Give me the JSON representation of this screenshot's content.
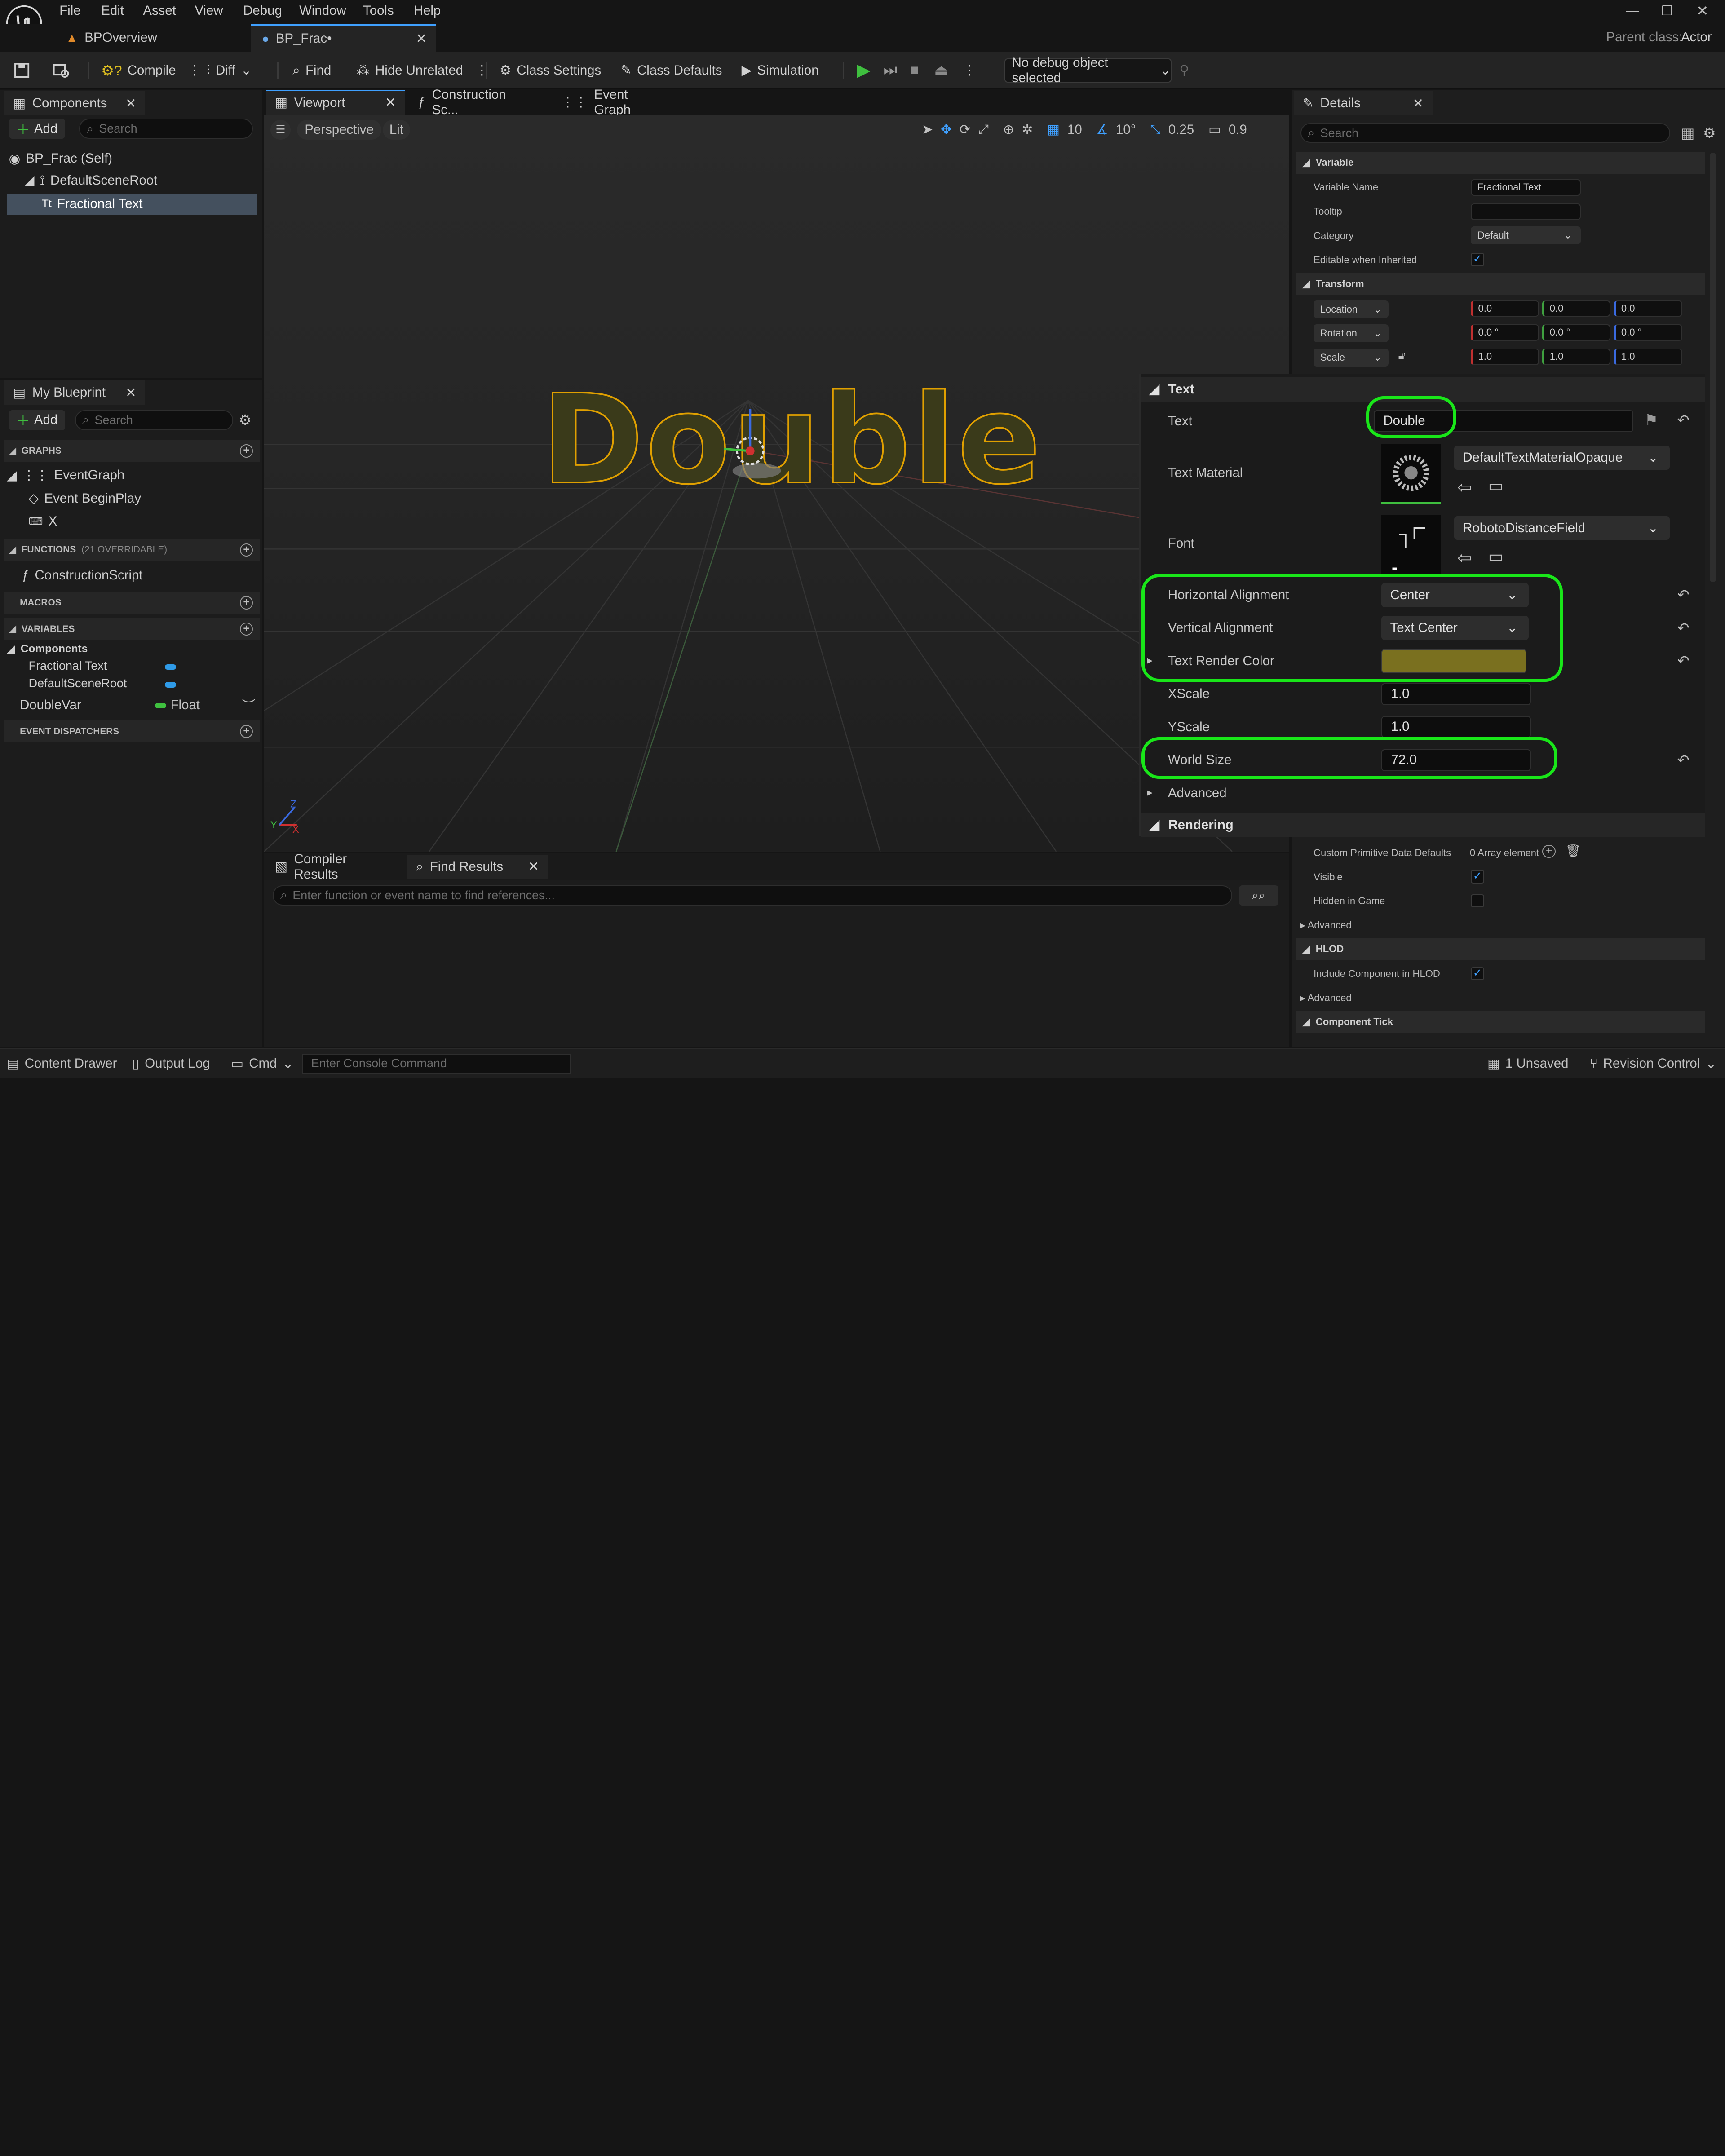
{
  "menu": [
    "File",
    "Edit",
    "Asset",
    "View",
    "Debug",
    "Window",
    "Tools",
    "Help"
  ],
  "doc_tabs": [
    {
      "label": "BPOverview"
    },
    {
      "label": "BP_Frac•"
    }
  ],
  "parent_class": {
    "label": "Parent class:",
    "value": "Actor"
  },
  "toolbar": {
    "compile": "Compile",
    "diff": "Diff",
    "find": "Find",
    "hide_unrelated": "Hide Unrelated",
    "class_settings": "Class Settings",
    "class_defaults": "Class Defaults",
    "simulation": "Simulation",
    "debug_object": "No debug object selected"
  },
  "components": {
    "tab": "Components",
    "add": "Add",
    "search_placeholder": "Search",
    "items": [
      "BP_Frac (Self)",
      "DefaultSceneRoot",
      "Fractional Text"
    ]
  },
  "viewport": {
    "tabs": [
      "Viewport",
      "Construction Sc...",
      "Event Graph"
    ],
    "perspective": "Perspective",
    "lit": "Lit",
    "grid_snap": "10",
    "rot_snap": "10°",
    "scale_snap": "0.25",
    "cam_speed": "0.9",
    "rendered_text": "Double"
  },
  "my_blueprint": {
    "tab": "My Blueprint",
    "add": "Add",
    "search_placeholder": "Search",
    "graphs_header": "GRAPHS",
    "event_graph": "EventGraph",
    "begin_play": "Event BeginPlay",
    "x_node": "X",
    "functions_header": "FUNCTIONS",
    "functions_note": "(21 OVERRIDABLE)",
    "construction_script": "ConstructionScript",
    "macros_header": "MACROS",
    "variables_header": "VARIABLES",
    "components_group": "Components",
    "var_items": [
      "Fractional Text",
      "DefaultSceneRoot"
    ],
    "double_var": {
      "name": "DoubleVar",
      "type": "Float"
    },
    "dispatchers_header": "EVENT DISPATCHERS"
  },
  "details": {
    "tab": "Details",
    "search_placeholder": "Search",
    "variable_section": "Variable",
    "variable_name_label": "Variable Name",
    "variable_name": "Fractional Text",
    "tooltip_label": "Tooltip",
    "category_label": "Category",
    "category": "Default",
    "editable_label": "Editable when Inherited",
    "transform_section": "Transform",
    "location": "Location",
    "rotation": "Rotation",
    "scale": "Scale",
    "loc_vals": [
      "0.0",
      "0.0",
      "0.0"
    ],
    "rot_vals": [
      "0.0 °",
      "0.0 °",
      "0.0 °"
    ],
    "scale_vals": [
      "1.0",
      "1.0",
      "1.0"
    ],
    "custom_prim_label": "Custom Primitive Data Defaults",
    "custom_prim_val": "0 Array element",
    "visible_label": "Visible",
    "hidden_label": "Hidden in Game",
    "advanced": "Advanced",
    "hlod_section": "HLOD",
    "include_hlod_label": "Include Component in HLOD",
    "component_tick_section": "Component Tick"
  },
  "text_panel": {
    "section": "Text",
    "text_label": "Text",
    "text_value": "Double",
    "material_label": "Text Material",
    "material_value": "DefaultTextMaterialOpaque",
    "font_label": "Font",
    "font_value": "RobotoDistanceField",
    "halign_label": "Horizontal Alignment",
    "halign_value": "Center",
    "valign_label": "Vertical Alignment",
    "valign_value": "Text Center",
    "color_label": "Text Render Color",
    "color_value": "#7a701f",
    "xscale_label": "XScale",
    "xscale_value": "1.0",
    "yscale_label": "YScale",
    "yscale_value": "1.0",
    "world_size_label": "World Size",
    "world_size_value": "72.0",
    "advanced": "Advanced",
    "rendering": "Rendering"
  },
  "bottom": {
    "compiler_results": "Compiler Results",
    "find_results": "Find Results",
    "find_placeholder": "Enter function or event name to find references..."
  },
  "status": {
    "content_drawer": "Content Drawer",
    "output_log": "Output Log",
    "cmd": "Cmd",
    "console_placeholder": "Enter Console Command",
    "unsaved": "1 Unsaved",
    "revision": "Revision Control"
  },
  "colors": {
    "highlight": "#19e619",
    "accent_blue": "#3fa0ff",
    "play_green": "#3fbf3f",
    "text_outline": "#e0a000"
  }
}
